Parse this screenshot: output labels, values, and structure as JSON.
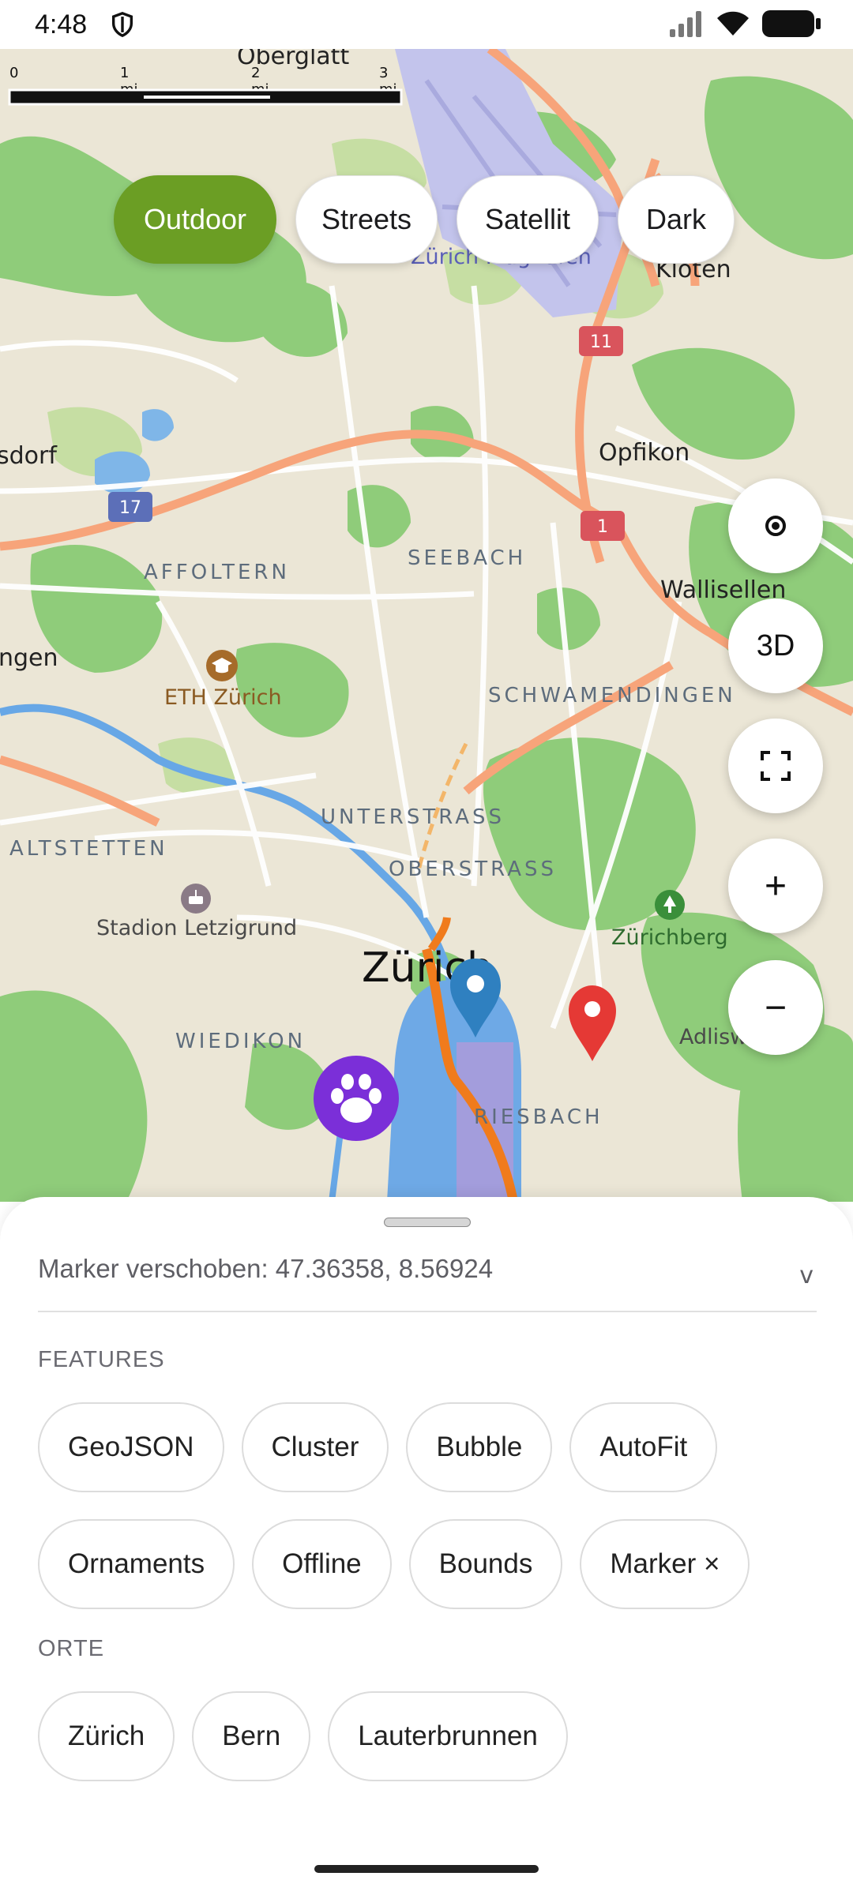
{
  "status_bar": {
    "time": "4:48",
    "icons": [
      "shield-icon",
      "signal-icon",
      "wifi-icon",
      "battery-icon"
    ]
  },
  "map": {
    "scale": {
      "labels": [
        "0",
        "1 mi",
        "2 mi",
        "3 mi"
      ]
    },
    "style_buttons": [
      {
        "label": "Outdoor",
        "active": true
      },
      {
        "label": "Streets",
        "active": false
      },
      {
        "label": "Satellit",
        "active": false
      },
      {
        "label": "Dark",
        "active": false
      }
    ],
    "controls": {
      "locate": "locate-icon",
      "three_d": "3D",
      "fullscreen": "fullscreen-icon",
      "zoom_in": "+",
      "zoom_out": "−"
    },
    "labels": {
      "oberglatt": "Oberglatt",
      "zurich_airport": "Zürich Flughafen",
      "kloten": "Kloten",
      "opfikon": "Opfikon",
      "wallisellen": "Wallisellen",
      "regensdorf": "sdorf",
      "affoltern": "AFFOLTERN",
      "seebach": "SEEBACH",
      "eth": "ETH Zürich",
      "schwamendingen": "SCHWAMENDINGEN",
      "hongg": "ngen",
      "unterstrass": "UNTERSTRASS",
      "oberstrass": "OBERSTRASS",
      "altstetten": "ALTSTETTEN",
      "stadion": "Stadion Letzigrund",
      "zurichberg": "Zürichberg",
      "zurich": "Zürich",
      "wiedikon": "WIEDIKON",
      "adliswil": "Adlisw",
      "riesbach": "RIESBACH"
    },
    "road_shields": [
      "11",
      "17",
      "1"
    ],
    "markers": [
      "blue-marker",
      "red-marker",
      "paw-marker"
    ],
    "colors": {
      "active_style": "#6b9e24",
      "blue_marker": "#2f80c0",
      "red_marker": "#e53935",
      "paw_marker": "#7b2fd8",
      "route": "#f07b1c"
    }
  },
  "sheet": {
    "status": "Marker verschoben: 47.36358, 8.56924",
    "features_title": "FEATURES",
    "features": [
      "GeoJSON",
      "Cluster",
      "Bubble",
      "AutoFit",
      "Ornaments",
      "Offline",
      "Bounds",
      "Marker ×"
    ],
    "places_title": "ORTE",
    "places": [
      "Zürich",
      "Bern",
      "Lauterbrunnen"
    ]
  }
}
